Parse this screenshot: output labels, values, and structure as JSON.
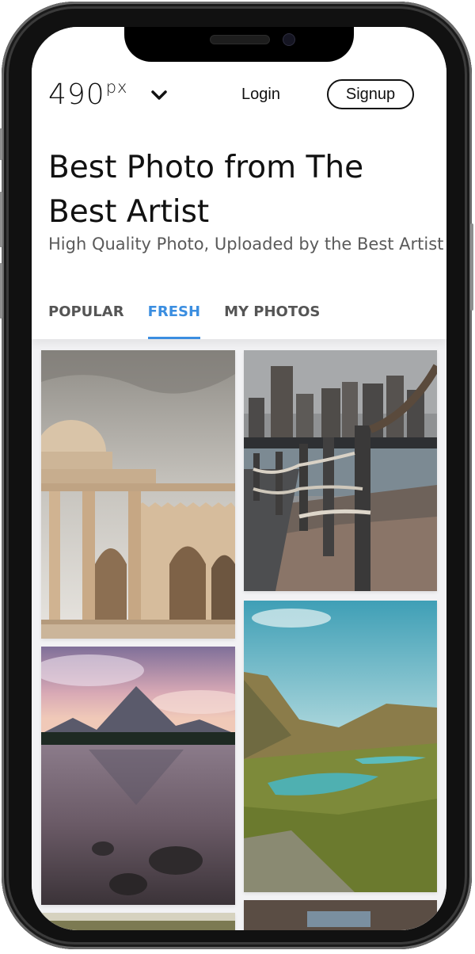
{
  "brand": {
    "logo_main": "490",
    "logo_sup": "px"
  },
  "nav": {
    "login_label": "Login",
    "signup_label": "Signup"
  },
  "hero": {
    "title": "Best Photo from The Best Artist",
    "subtitle": "High Quality Photo, Uploaded by the Best Artist"
  },
  "tabs": [
    {
      "label": "POPULAR",
      "active": false
    },
    {
      "label": "FRESH",
      "active": true
    },
    {
      "label": "MY PHOTOS",
      "active": false
    }
  ],
  "colors": {
    "accent": "#3b8ee0",
    "text": "#111111",
    "muted": "#5a5a5a"
  },
  "icons": {
    "dropdown": "chevron-down-icon"
  },
  "photos": [
    {
      "subject": "mosque"
    },
    {
      "subject": "city-pier"
    },
    {
      "subject": "mountain-lake"
    },
    {
      "subject": "alpine-valley"
    },
    {
      "subject": "partial-bottom-left"
    },
    {
      "subject": "partial-bottom-right"
    }
  ]
}
